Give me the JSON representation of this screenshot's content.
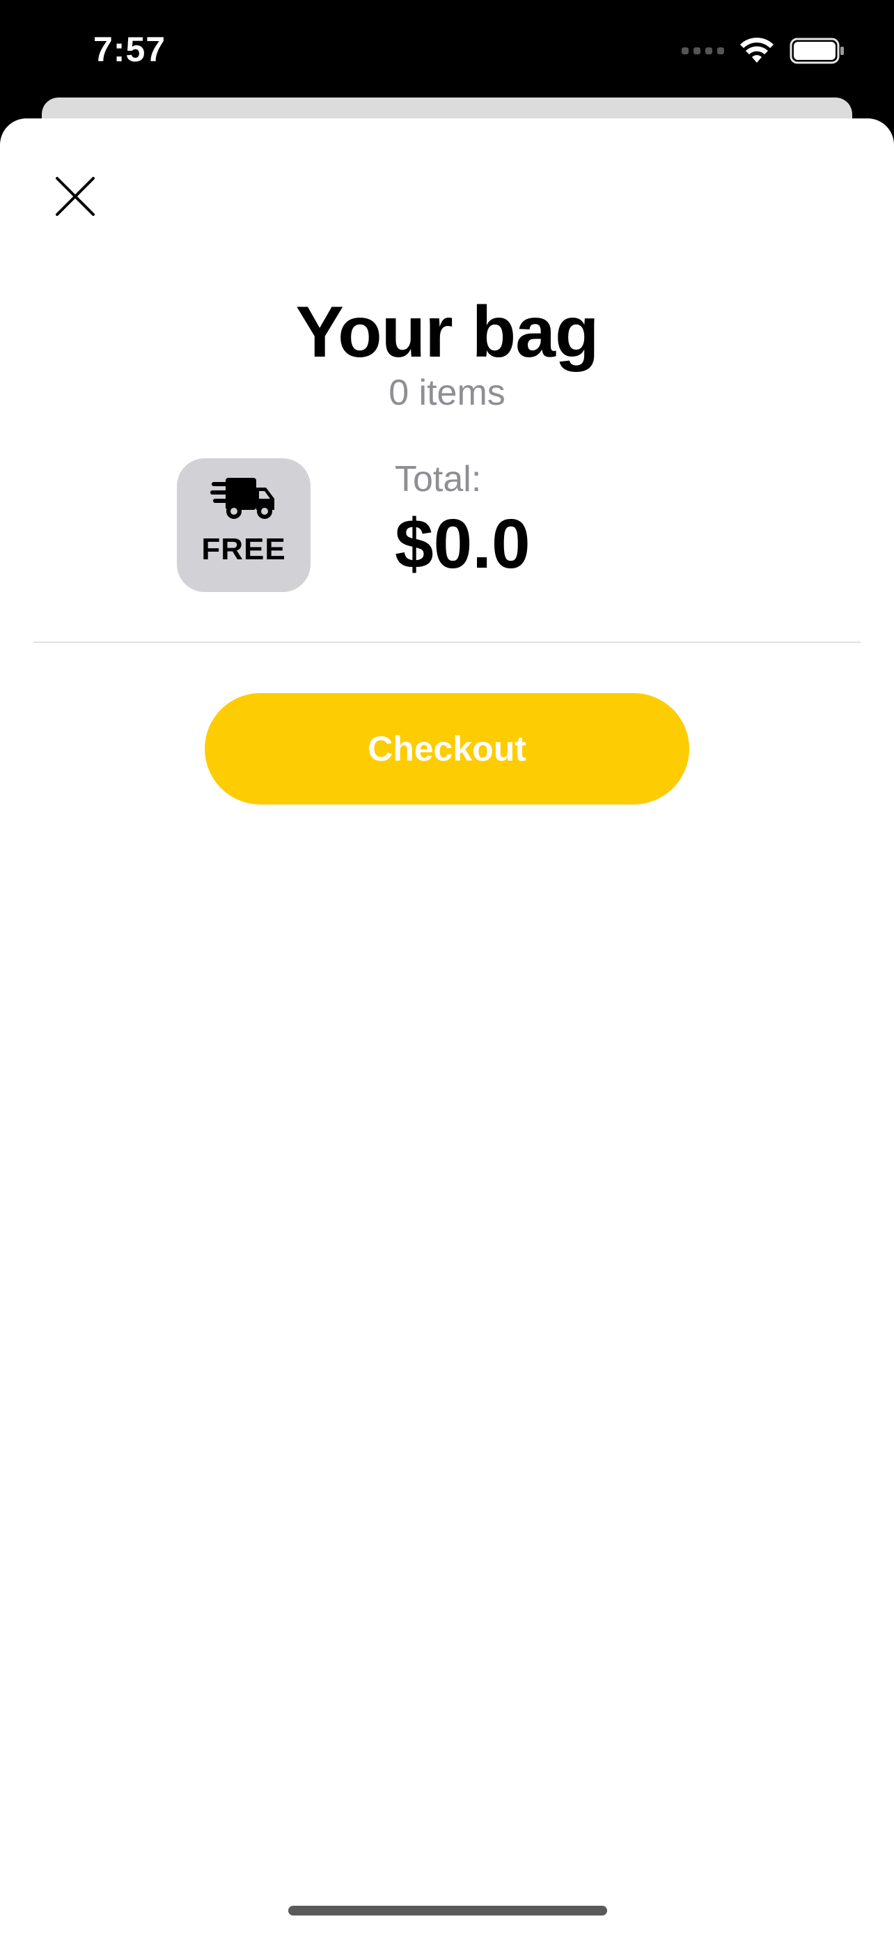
{
  "status_bar": {
    "time": "7:57",
    "icons": [
      "cellular-signal-icon",
      "wifi-icon",
      "battery-icon"
    ]
  },
  "sheet": {
    "close_icon": "close-icon",
    "title": "Your bag",
    "item_count": "0 items",
    "shipping_badge": {
      "icon": "delivery-truck-icon",
      "label": "FREE"
    },
    "total_label": "Total:",
    "total_value": "$0.0",
    "checkout_label": "Checkout"
  },
  "colors": {
    "accent": "#fecc02",
    "badge_background": "#d1d1d6",
    "secondary_text": "#8e8e93",
    "status_bar_background": "#000000"
  }
}
